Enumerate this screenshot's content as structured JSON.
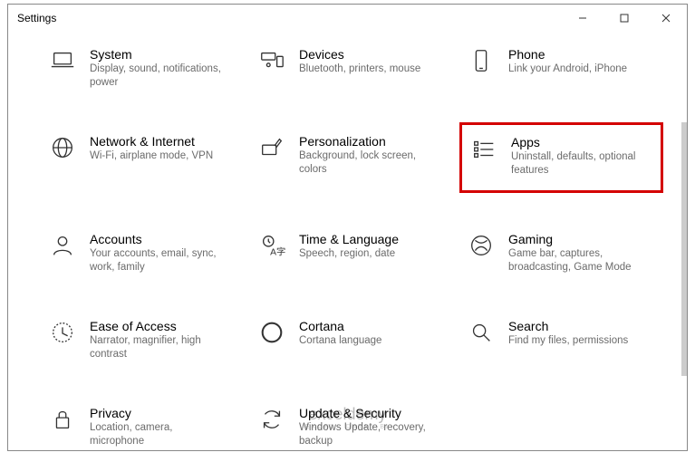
{
  "window": {
    "title": "Settings"
  },
  "tiles": {
    "system": {
      "title": "System",
      "desc": "Display, sound, notifications, power"
    },
    "devices": {
      "title": "Devices",
      "desc": "Bluetooth, printers, mouse"
    },
    "phone": {
      "title": "Phone",
      "desc": "Link your Android, iPhone"
    },
    "network": {
      "title": "Network & Internet",
      "desc": "Wi-Fi, airplane mode, VPN"
    },
    "personalization": {
      "title": "Personalization",
      "desc": "Background, lock screen, colors"
    },
    "apps": {
      "title": "Apps",
      "desc": "Uninstall, defaults, optional features"
    },
    "accounts": {
      "title": "Accounts",
      "desc": "Your accounts, email, sync, work, family"
    },
    "time": {
      "title": "Time & Language",
      "desc": "Speech, region, date"
    },
    "gaming": {
      "title": "Gaming",
      "desc": "Game bar, captures, broadcasting, Game Mode"
    },
    "ease": {
      "title": "Ease of Access",
      "desc": "Narrator, magnifier, high contrast"
    },
    "cortana": {
      "title": "Cortana",
      "desc": "Cortana language"
    },
    "search": {
      "title": "Search",
      "desc": "Find my files, permissions"
    },
    "privacy": {
      "title": "Privacy",
      "desc": "Location, camera, microphone"
    },
    "update": {
      "title": "Update & Security",
      "desc": "Windows Update, recovery, backup"
    }
  },
  "watermark": {
    "main": "exceldemy",
    "sub": "EXCEL · DATA · BI"
  },
  "highlight": "apps"
}
